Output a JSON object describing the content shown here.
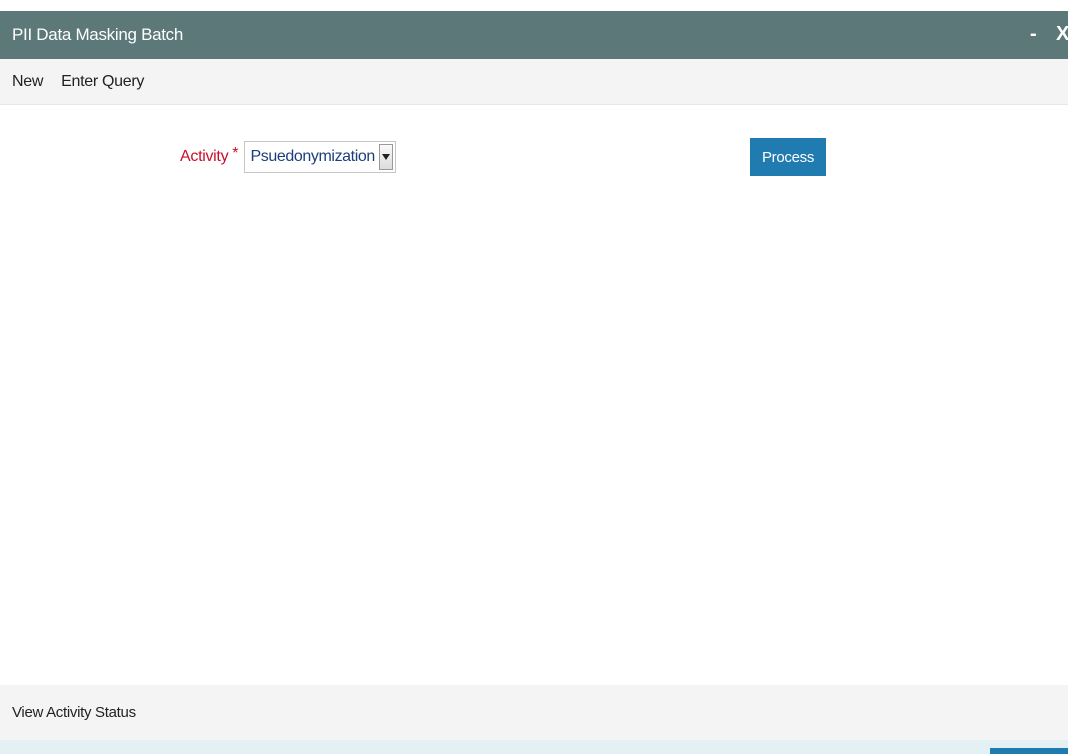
{
  "window": {
    "title": "PII Data Masking Batch",
    "minimize_label": "-",
    "close_label": "X"
  },
  "toolbar": {
    "new_label": "New",
    "enter_query_label": "Enter Query"
  },
  "form": {
    "activity_label": "Activity",
    "required_marker": "*",
    "activity_value": "Psuedonymization",
    "process_label": "Process"
  },
  "footer": {
    "view_activity_status_label": "View Activity Status"
  },
  "colors": {
    "titlebar": "#5c7878",
    "accent": "#1f7bb0",
    "required": "#c8102e"
  },
  "icons": {
    "dropdown": "chevron-down-icon"
  }
}
